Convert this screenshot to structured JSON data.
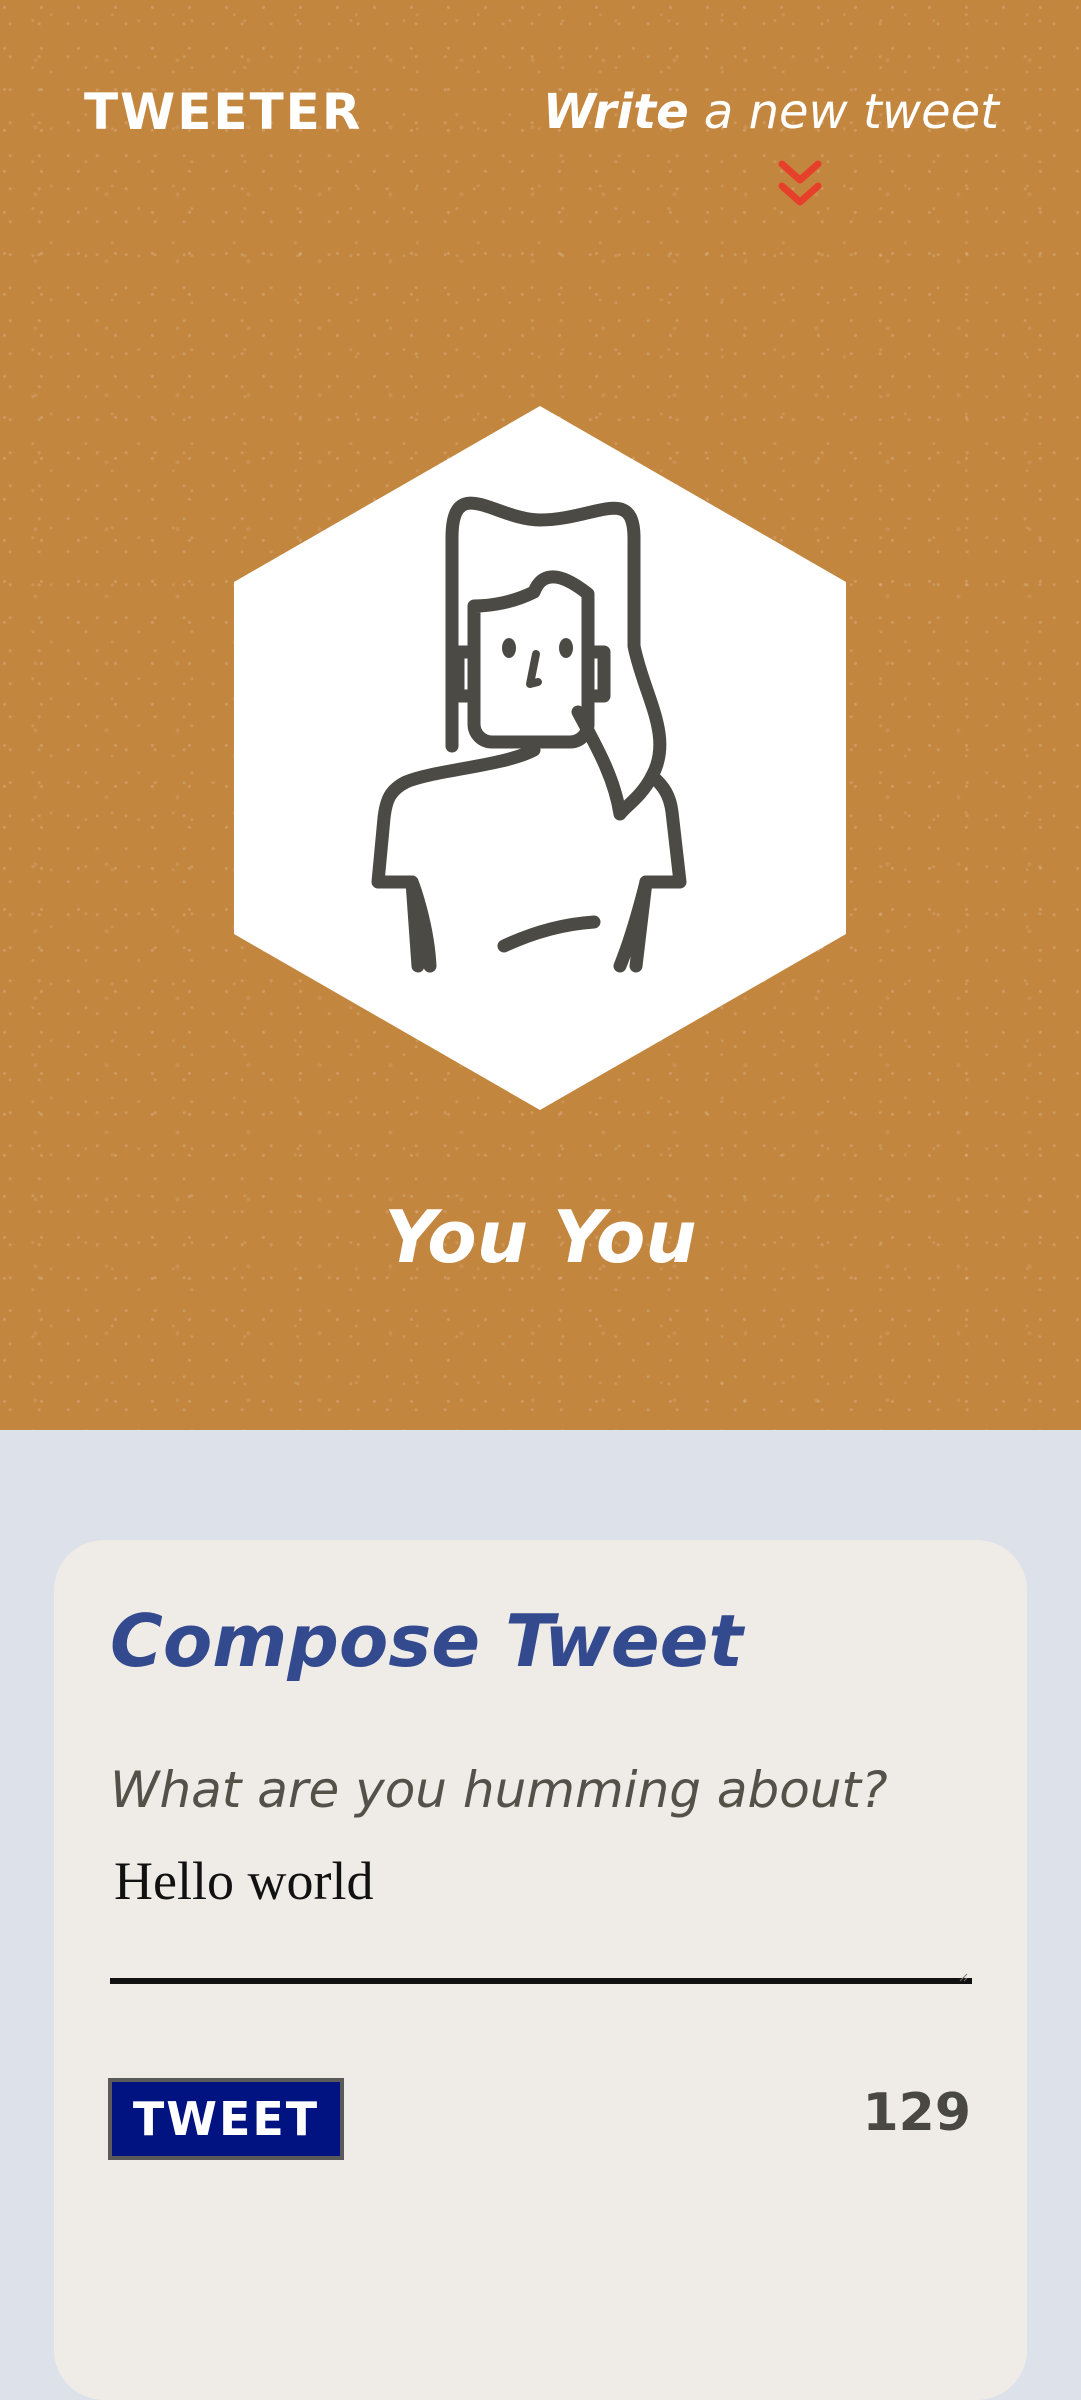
{
  "header": {
    "logo": "TWEETER",
    "write_strong": "Write",
    "write_rest": "a new tweet",
    "chevron_icon": "chevron-double-down-icon",
    "avatar_icon": "user-avatar-icon",
    "username": "You You"
  },
  "compose": {
    "title": "Compose Tweet",
    "prompt_label": "What are you humming about?",
    "input_value": "Hello world",
    "button_label": "TWEET",
    "char_counter": "129"
  },
  "colors": {
    "header_bg": "#c3863f",
    "page_bg": "#dce1ea",
    "card_bg": "#efebe7",
    "title_blue": "#344a8e",
    "button_navy": "#011281",
    "chevron_red": "#e7402a",
    "avatar_stroke": "#4b4a44"
  }
}
